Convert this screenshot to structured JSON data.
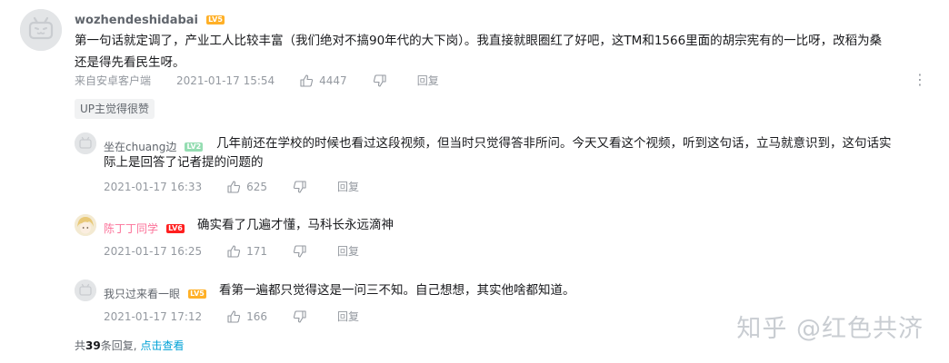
{
  "main_comment": {
    "username": "wozhendeshidabai",
    "level": "LV5",
    "text_line1": "第一句话就定调了，产业工人比较丰富（我们绝对不搞90年代的大下岗）。我直接就眼圈红了好吧，这TM和1566里面的胡宗宪有的一比呀，改稻为桑",
    "text_line2": "还是得先看民生呀。",
    "source": "来自安卓客户端",
    "time": "2021-01-17 15:54",
    "likes": "4447",
    "reply_label": "回复",
    "up_tag": "UP主觉得很赞"
  },
  "replies": [
    {
      "username": "坐在chuang边",
      "level": "LV2",
      "text_line1": "几年前还在学校的时候也看过这段视频，但当时只觉得答非所问。今天又看这个视频，听到这句话，立马就意识到，这句话实",
      "text_line2": "际上是回答了记者提的问题的",
      "time": "2021-01-17 16:33",
      "likes": "625",
      "reply_label": "回复"
    },
    {
      "username": "陈丁丁同学",
      "level": "LV6",
      "text_line1": "确实看了几遍才懂，马科长永远滴神",
      "time": "2021-01-17 16:25",
      "likes": "171",
      "reply_label": "回复"
    },
    {
      "username": "我只过来看一眼",
      "level": "LV5",
      "text_line1": "看第一遍都只觉得这是一问三不知。自己想想，其实他啥都知道。",
      "time": "2021-01-17 17:12",
      "likes": "166",
      "reply_label": "回复"
    }
  ],
  "footer": {
    "prefix": "共",
    "count": "39",
    "suffix": "条回复,",
    "view_link": "点击查看"
  },
  "watermark": "知乎 @红色共济",
  "colors": {
    "pink_username": "#fb7299",
    "link": "#00a1d6",
    "meta_gray": "#9499a0"
  }
}
